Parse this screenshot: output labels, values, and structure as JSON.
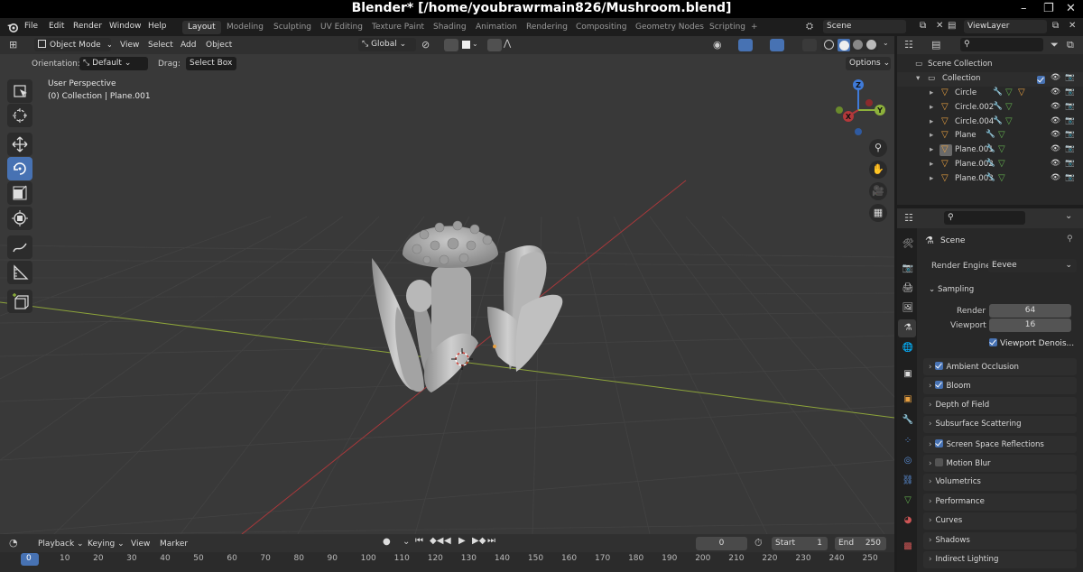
{
  "window": {
    "title": "Blender* [/home/youbrawrmain826/Mushroom.blend]",
    "controls": [
      "–",
      "❐",
      "✕"
    ]
  },
  "menu": [
    "File",
    "Edit",
    "Render",
    "Window",
    "Help"
  ],
  "workspaces": [
    "Layout",
    "Modeling",
    "Sculpting",
    "UV Editing",
    "Texture Paint",
    "Shading",
    "Animation",
    "Rendering",
    "Compositing",
    "Geometry Nodes",
    "Scripting",
    "+"
  ],
  "active_workspace": "Layout",
  "scene_field": "Scene",
  "viewlayer_field": "ViewLayer",
  "viewport_header": {
    "mode": "Object Mode",
    "menus": [
      "View",
      "Select",
      "Add",
      "Object"
    ],
    "transform_orientation": "Global"
  },
  "tool_settings": {
    "orientation_label": "Orientation:",
    "orientation_value": "Default",
    "drag_label": "Drag:",
    "drag_value": "Select Box",
    "options": "Options"
  },
  "viewport": {
    "view_name": "User Perspective",
    "collection_info": "(0) Collection | Plane.001",
    "gizmo_axes": [
      "X",
      "Y",
      "Z"
    ]
  },
  "outliner": {
    "root": "Scene Collection",
    "collection": "Collection",
    "objects": [
      "Circle",
      "Circle.002",
      "Circle.004",
      "Plane",
      "Plane.001",
      "Plane.002",
      "Plane.003"
    ],
    "selected": "Plane.001"
  },
  "properties": {
    "context": "Scene",
    "render_engine_label": "Render Engine",
    "render_engine": "Eevee",
    "sampling": {
      "title": "Sampling",
      "render_label": "Render",
      "render_value": "64",
      "viewport_label": "Viewport",
      "viewport_value": "16",
      "denoise_label": "Viewport Denois..."
    },
    "panels": [
      {
        "label": "Ambient Occlusion",
        "checkbox": true
      },
      {
        "label": "Bloom",
        "checkbox": true
      },
      {
        "label": "Depth of Field",
        "checkbox": null
      },
      {
        "label": "Subsurface Scattering",
        "checkbox": null
      },
      {
        "label": "Screen Space Reflections",
        "checkbox": true
      },
      {
        "label": "Motion Blur",
        "checkbox": false
      },
      {
        "label": "Volumetrics",
        "checkbox": null
      },
      {
        "label": "Performance",
        "checkbox": null
      },
      {
        "label": "Curves",
        "checkbox": null
      },
      {
        "label": "Shadows",
        "checkbox": null
      },
      {
        "label": "Indirect Lighting",
        "checkbox": null
      }
    ]
  },
  "timeline": {
    "menus": [
      "Playback",
      "Keying",
      "View",
      "Marker"
    ],
    "current_frame": "0",
    "start_label": "Start",
    "start_value": "1",
    "end_label": "End",
    "end_value": "250",
    "ruler": [
      "0",
      "10",
      "20",
      "30",
      "40",
      "50",
      "60",
      "70",
      "80",
      "90",
      "100",
      "110",
      "120",
      "130",
      "140",
      "150",
      "160",
      "170",
      "180",
      "190",
      "200",
      "210",
      "220",
      "230",
      "240",
      "250"
    ]
  },
  "colors": {
    "accent": "#4772b3",
    "x_axis": "#b3383a",
    "y_axis": "#8db13b",
    "z_axis": "#3f7ad8",
    "object_orange": "#e8a040"
  }
}
